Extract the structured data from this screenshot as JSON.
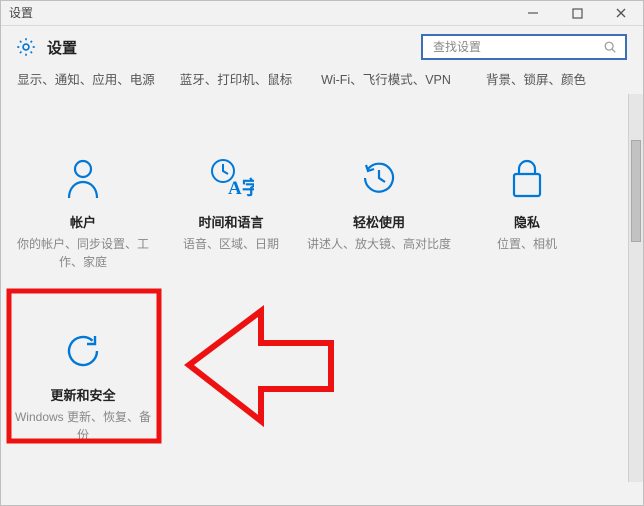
{
  "window": {
    "title": "设置"
  },
  "header": {
    "page_title": "设置",
    "search_placeholder": "查找设置"
  },
  "categories": [
    "显示、通知、应用、电源",
    "蓝牙、打印机、鼠标",
    "Wi-Fi、飞行模式、VPN",
    "背景、锁屏、颜色"
  ],
  "tiles": [
    {
      "title": "帐户",
      "subtitle": "你的帐户、同步设置、工作、家庭"
    },
    {
      "title": "时间和语言",
      "subtitle": "语音、区域、日期"
    },
    {
      "title": "轻松使用",
      "subtitle": "讲述人、放大镜、高对比度"
    },
    {
      "title": "隐私",
      "subtitle": "位置、相机"
    },
    {
      "title": "更新和安全",
      "subtitle": "Windows 更新、恢复、备份"
    }
  ]
}
